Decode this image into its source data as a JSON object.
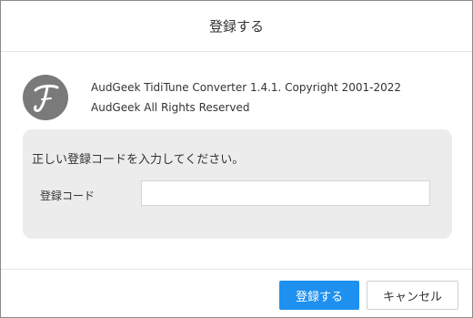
{
  "dialog": {
    "title": "登録する"
  },
  "about": {
    "logo_icon": "tiditune-logo-icon",
    "line1": "AudGeek TidiTune Converter 1.4.1. Copyright 2001-2022",
    "line2": "AudGeek All Rights Reserved"
  },
  "registration": {
    "prompt": "正しい登録コードを入力してください。",
    "code_label": "登録コード",
    "code_value": ""
  },
  "buttons": {
    "register_label": "登録する",
    "cancel_label": "キャンセル"
  },
  "colors": {
    "primary": "#1e90ef",
    "panel_bg": "#ececec",
    "logo_bg": "#7a7a7a"
  }
}
